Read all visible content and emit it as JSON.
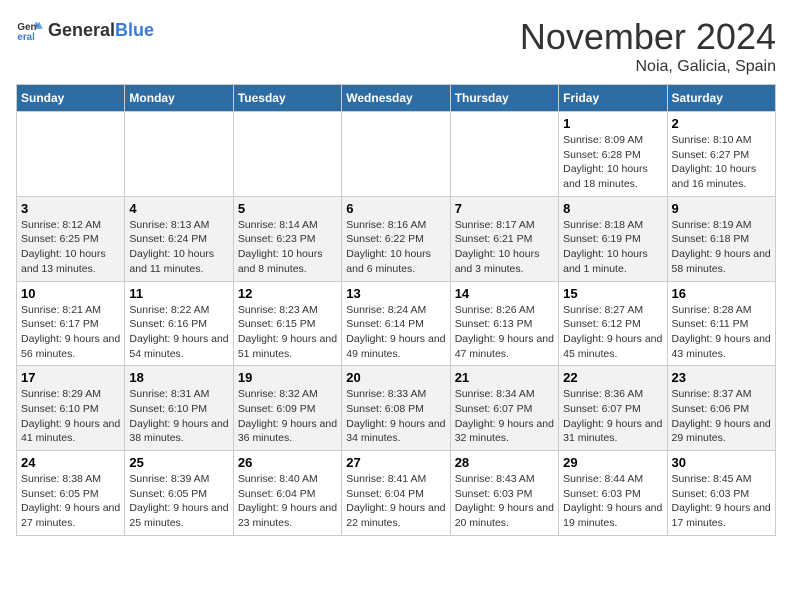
{
  "header": {
    "logo_general": "General",
    "logo_blue": "Blue",
    "month_title": "November 2024",
    "location": "Noia, Galicia, Spain"
  },
  "days_of_week": [
    "Sunday",
    "Monday",
    "Tuesday",
    "Wednesday",
    "Thursday",
    "Friday",
    "Saturday"
  ],
  "weeks": [
    [
      {
        "day": "",
        "info": ""
      },
      {
        "day": "",
        "info": ""
      },
      {
        "day": "",
        "info": ""
      },
      {
        "day": "",
        "info": ""
      },
      {
        "day": "",
        "info": ""
      },
      {
        "day": "1",
        "info": "Sunrise: 8:09 AM\nSunset: 6:28 PM\nDaylight: 10 hours and 18 minutes."
      },
      {
        "day": "2",
        "info": "Sunrise: 8:10 AM\nSunset: 6:27 PM\nDaylight: 10 hours and 16 minutes."
      }
    ],
    [
      {
        "day": "3",
        "info": "Sunrise: 8:12 AM\nSunset: 6:25 PM\nDaylight: 10 hours and 13 minutes."
      },
      {
        "day": "4",
        "info": "Sunrise: 8:13 AM\nSunset: 6:24 PM\nDaylight: 10 hours and 11 minutes."
      },
      {
        "day": "5",
        "info": "Sunrise: 8:14 AM\nSunset: 6:23 PM\nDaylight: 10 hours and 8 minutes."
      },
      {
        "day": "6",
        "info": "Sunrise: 8:16 AM\nSunset: 6:22 PM\nDaylight: 10 hours and 6 minutes."
      },
      {
        "day": "7",
        "info": "Sunrise: 8:17 AM\nSunset: 6:21 PM\nDaylight: 10 hours and 3 minutes."
      },
      {
        "day": "8",
        "info": "Sunrise: 8:18 AM\nSunset: 6:19 PM\nDaylight: 10 hours and 1 minute."
      },
      {
        "day": "9",
        "info": "Sunrise: 8:19 AM\nSunset: 6:18 PM\nDaylight: 9 hours and 58 minutes."
      }
    ],
    [
      {
        "day": "10",
        "info": "Sunrise: 8:21 AM\nSunset: 6:17 PM\nDaylight: 9 hours and 56 minutes."
      },
      {
        "day": "11",
        "info": "Sunrise: 8:22 AM\nSunset: 6:16 PM\nDaylight: 9 hours and 54 minutes."
      },
      {
        "day": "12",
        "info": "Sunrise: 8:23 AM\nSunset: 6:15 PM\nDaylight: 9 hours and 51 minutes."
      },
      {
        "day": "13",
        "info": "Sunrise: 8:24 AM\nSunset: 6:14 PM\nDaylight: 9 hours and 49 minutes."
      },
      {
        "day": "14",
        "info": "Sunrise: 8:26 AM\nSunset: 6:13 PM\nDaylight: 9 hours and 47 minutes."
      },
      {
        "day": "15",
        "info": "Sunrise: 8:27 AM\nSunset: 6:12 PM\nDaylight: 9 hours and 45 minutes."
      },
      {
        "day": "16",
        "info": "Sunrise: 8:28 AM\nSunset: 6:11 PM\nDaylight: 9 hours and 43 minutes."
      }
    ],
    [
      {
        "day": "17",
        "info": "Sunrise: 8:29 AM\nSunset: 6:10 PM\nDaylight: 9 hours and 41 minutes."
      },
      {
        "day": "18",
        "info": "Sunrise: 8:31 AM\nSunset: 6:10 PM\nDaylight: 9 hours and 38 minutes."
      },
      {
        "day": "19",
        "info": "Sunrise: 8:32 AM\nSunset: 6:09 PM\nDaylight: 9 hours and 36 minutes."
      },
      {
        "day": "20",
        "info": "Sunrise: 8:33 AM\nSunset: 6:08 PM\nDaylight: 9 hours and 34 minutes."
      },
      {
        "day": "21",
        "info": "Sunrise: 8:34 AM\nSunset: 6:07 PM\nDaylight: 9 hours and 32 minutes."
      },
      {
        "day": "22",
        "info": "Sunrise: 8:36 AM\nSunset: 6:07 PM\nDaylight: 9 hours and 31 minutes."
      },
      {
        "day": "23",
        "info": "Sunrise: 8:37 AM\nSunset: 6:06 PM\nDaylight: 9 hours and 29 minutes."
      }
    ],
    [
      {
        "day": "24",
        "info": "Sunrise: 8:38 AM\nSunset: 6:05 PM\nDaylight: 9 hours and 27 minutes."
      },
      {
        "day": "25",
        "info": "Sunrise: 8:39 AM\nSunset: 6:05 PM\nDaylight: 9 hours and 25 minutes."
      },
      {
        "day": "26",
        "info": "Sunrise: 8:40 AM\nSunset: 6:04 PM\nDaylight: 9 hours and 23 minutes."
      },
      {
        "day": "27",
        "info": "Sunrise: 8:41 AM\nSunset: 6:04 PM\nDaylight: 9 hours and 22 minutes."
      },
      {
        "day": "28",
        "info": "Sunrise: 8:43 AM\nSunset: 6:03 PM\nDaylight: 9 hours and 20 minutes."
      },
      {
        "day": "29",
        "info": "Sunrise: 8:44 AM\nSunset: 6:03 PM\nDaylight: 9 hours and 19 minutes."
      },
      {
        "day": "30",
        "info": "Sunrise: 8:45 AM\nSunset: 6:03 PM\nDaylight: 9 hours and 17 minutes."
      }
    ]
  ]
}
